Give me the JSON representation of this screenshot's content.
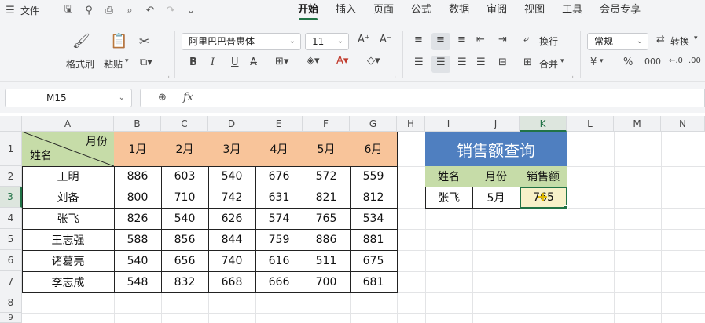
{
  "menubar": {
    "file_label": "文件",
    "tabs": [
      "开始",
      "插入",
      "页面",
      "公式",
      "数据",
      "审阅",
      "视图",
      "工具",
      "会员专享"
    ],
    "active_tab": "开始"
  },
  "ribbon": {
    "format_painter": "格式刷",
    "paste": "粘贴",
    "font_name": "阿里巴巴普惠体",
    "font_size": "11",
    "wrap_label": "换行",
    "merge_label": "合并",
    "number_format": "常规",
    "convert_label": "转换",
    "bold": "B",
    "italic": "I",
    "underline": "U",
    "currency": "¥",
    "percent": "%"
  },
  "formula_bar": {
    "cell_ref": "M15",
    "fx": "fx",
    "content": ""
  },
  "sheet": {
    "columns": [
      "A",
      "B",
      "C",
      "D",
      "E",
      "F",
      "G",
      "H",
      "I",
      "J",
      "K",
      "L",
      "M",
      "N"
    ],
    "rows": [
      "1",
      "2",
      "3",
      "4",
      "5",
      "6",
      "7",
      "8",
      "9"
    ],
    "header_top": "月份",
    "header_bottom": "姓名",
    "months": [
      "1月",
      "2月",
      "3月",
      "4月",
      "5月",
      "6月"
    ],
    "data": [
      {
        "name": "王明",
        "values": [
          "886",
          "603",
          "540",
          "676",
          "572",
          "559"
        ]
      },
      {
        "name": "刘备",
        "values": [
          "800",
          "710",
          "742",
          "631",
          "821",
          "812"
        ]
      },
      {
        "name": "张飞",
        "values": [
          "826",
          "540",
          "626",
          "574",
          "765",
          "534"
        ]
      },
      {
        "name": "王志强",
        "values": [
          "588",
          "856",
          "844",
          "759",
          "886",
          "881"
        ]
      },
      {
        "name": "诸葛亮",
        "values": [
          "540",
          "656",
          "740",
          "616",
          "511",
          "675"
        ]
      },
      {
        "name": "李志成",
        "values": [
          "548",
          "832",
          "668",
          "666",
          "700",
          "681"
        ]
      }
    ],
    "lookup": {
      "title": "销售额查询",
      "headers": [
        "姓名",
        "月份",
        "销售额"
      ],
      "name": "张飞",
      "month": "5月",
      "result": "765"
    }
  },
  "colors": {
    "accent": "#217346",
    "orange_header": "#f8c49a",
    "green_header": "#c6dca8",
    "blue_title": "#4f7fc0"
  }
}
